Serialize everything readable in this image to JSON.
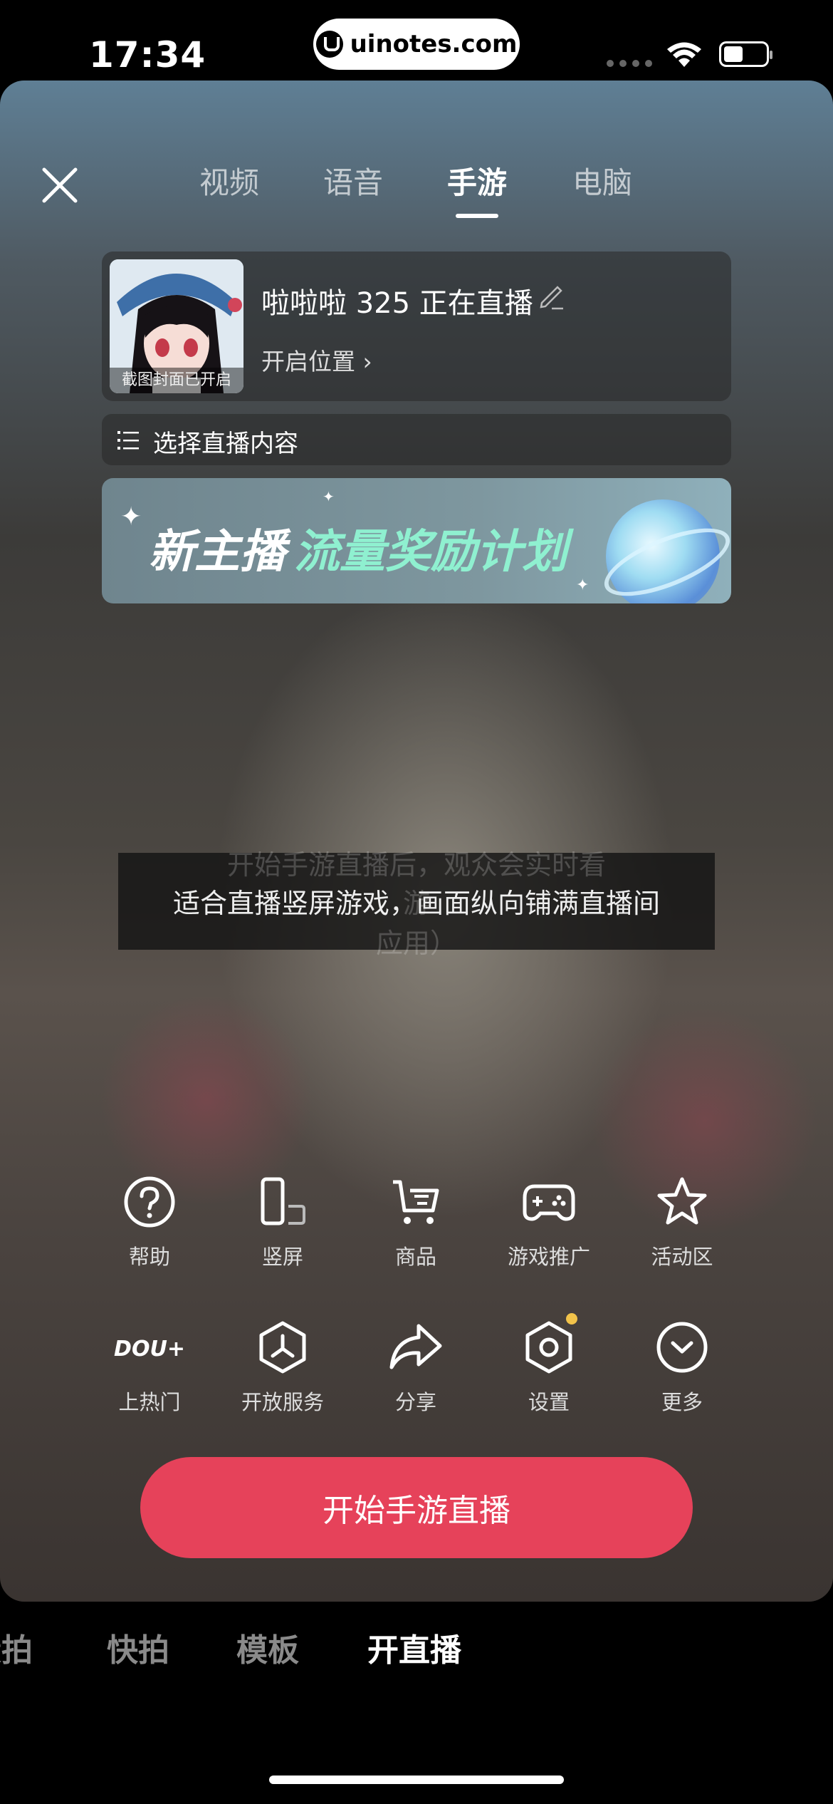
{
  "status_bar": {
    "time": "17:34",
    "site": "uinotes.com"
  },
  "tabs": [
    {
      "label": "视频",
      "active": false
    },
    {
      "label": "语音",
      "active": false
    },
    {
      "label": "手游",
      "active": true
    },
    {
      "label": "电脑",
      "active": false
    }
  ],
  "live_card": {
    "cover_caption": "截图封面已开启",
    "title": "啦啦啦 325 正在直播",
    "location_label": "开启位置",
    "chevron": "›"
  },
  "select_content": {
    "label": "选择直播内容"
  },
  "banner": {
    "text_white": "新主播",
    "text_green": "流量奖励计划"
  },
  "hint": {
    "underlay_line1": "开始手游直播后，观众会实时看",
    "underlay_line2": "游",
    "underlay_line3": "应用）",
    "message": "适合直播竖屏游戏，画面纵向铺满直播间"
  },
  "tools_row1": [
    {
      "icon": "help-icon",
      "label": "帮助"
    },
    {
      "icon": "portrait-orientation-icon",
      "label": "竖屏"
    },
    {
      "icon": "cart-icon",
      "label": "商品"
    },
    {
      "icon": "gamepad-icon",
      "label": "游戏推广"
    },
    {
      "icon": "star-icon",
      "label": "活动区"
    }
  ],
  "tools_row2": [
    {
      "icon": "dou-plus-icon",
      "label": "上热门",
      "icon_text": "DOU+"
    },
    {
      "icon": "open-service-icon",
      "label": "开放服务"
    },
    {
      "icon": "share-icon",
      "label": "分享"
    },
    {
      "icon": "settings-icon",
      "label": "设置",
      "badge_color": "#f2c34a"
    },
    {
      "icon": "more-icon",
      "label": "更多"
    }
  ],
  "start_button": {
    "label": "开始手游直播",
    "color": "#e6425a"
  },
  "bottom_tabs": [
    {
      "label": "段拍",
      "active": false
    },
    {
      "label": "快拍",
      "active": false
    },
    {
      "label": "模板",
      "active": false
    },
    {
      "label": "开直播",
      "active": true
    }
  ]
}
